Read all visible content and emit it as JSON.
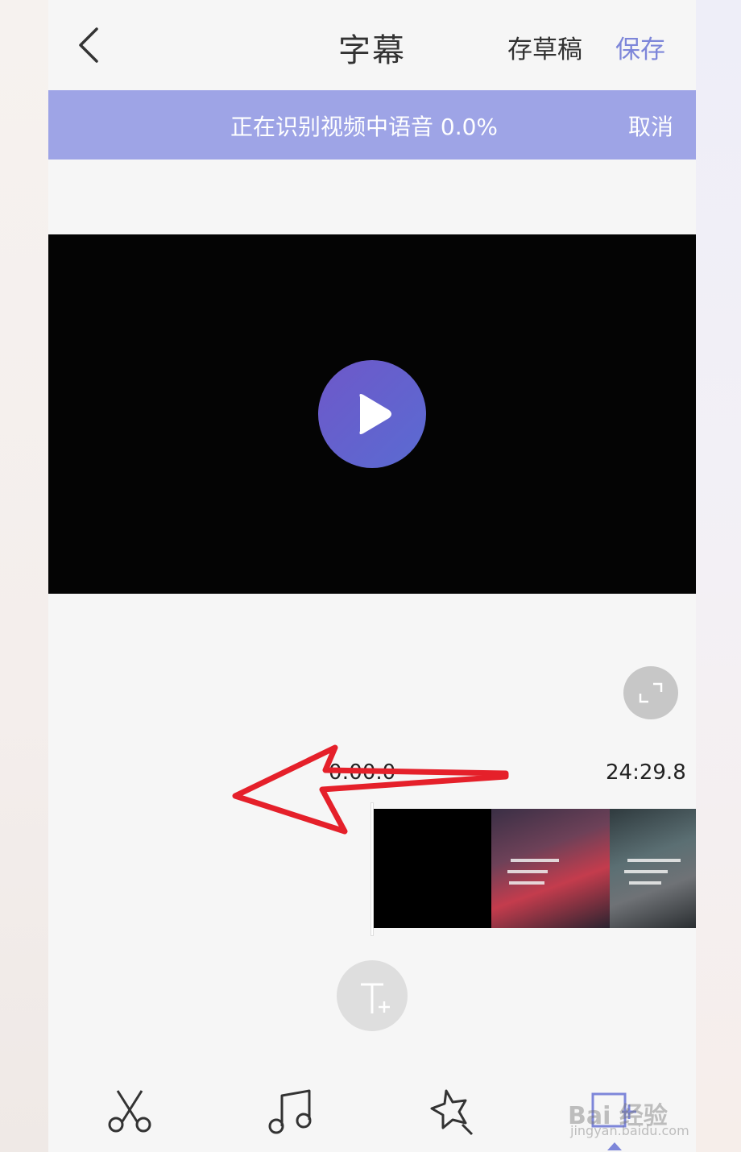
{
  "header": {
    "title": "字幕",
    "draft_label": "存草稿",
    "save_label": "保存"
  },
  "banner": {
    "message": "正在识别视频中语音 0.0%",
    "progress_percent": 0.0,
    "cancel_label": "取消"
  },
  "timeline": {
    "start_time": "0:00.0",
    "end_time": "24:29.8"
  },
  "toolbar": {
    "tabs": [
      {
        "icon": "scissors-icon"
      },
      {
        "icon": "music-note-icon"
      },
      {
        "icon": "magic-wand-icon"
      },
      {
        "icon": "subtitle-icon",
        "active": true
      }
    ]
  },
  "watermark": {
    "text": "Bai 经验",
    "url_text": "jingyan.baidu.com"
  },
  "colors": {
    "accent": "#7d86d9",
    "banner": "#9ea4e6",
    "play_button": "#6161cd",
    "annotation_arrow": "#e5202a"
  }
}
